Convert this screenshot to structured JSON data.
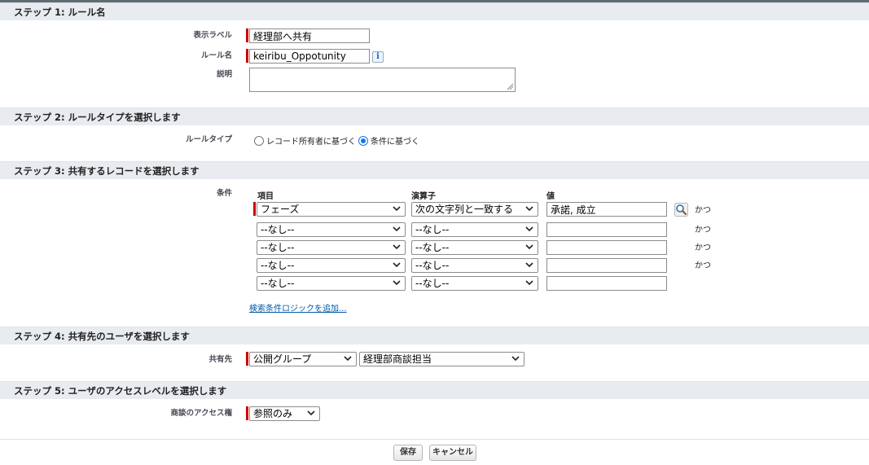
{
  "steps": {
    "step1": "ステップ 1: ルール名",
    "step2": "ステップ 2: ルールタイプを選択します",
    "step3": "ステップ 3: 共有するレコードを選択します",
    "step4": "ステップ 4: 共有先のユーザを選択します",
    "step5": "ステップ 5: ユーザのアクセスレベルを選択します"
  },
  "rule_name": {
    "label_display": "表示ラベル",
    "display_value": "経理部へ共有",
    "label_name": "ルール名",
    "name_value": "keiribu_Oppotunity",
    "label_description": "説明",
    "description_value": ""
  },
  "rule_type": {
    "label": "ルールタイプ",
    "option_owner": "レコード所有者に基づく",
    "option_criteria": "条件に基づく",
    "selected": "criteria"
  },
  "criteria": {
    "label": "条件",
    "col_field": "項目",
    "col_operator": "演算子",
    "col_value": "値",
    "and_label": "かつ",
    "rows": [
      {
        "field": "フェーズ",
        "operator": "次の文字列と一致する",
        "value": "承諾, 成立"
      },
      {
        "field": "--なし--",
        "operator": "--なし--",
        "value": ""
      },
      {
        "field": "--なし--",
        "operator": "--なし--",
        "value": ""
      },
      {
        "field": "--なし--",
        "operator": "--なし--",
        "value": ""
      },
      {
        "field": "--なし--",
        "operator": "--なし--",
        "value": ""
      }
    ],
    "add_logic_link": "検索条件ロジックを追加..."
  },
  "share_with": {
    "label": "共有先",
    "type_value": "公開グループ",
    "target_value": "経理部商談担当"
  },
  "access": {
    "label": "商談のアクセス権",
    "value": "参照のみ"
  },
  "buttons": {
    "save": "保存",
    "cancel": "キャンセル"
  },
  "icons": {
    "info": "info-icon",
    "lookup": "lookup-magnifier-icon",
    "dropdown": "chevron-down-icon"
  }
}
